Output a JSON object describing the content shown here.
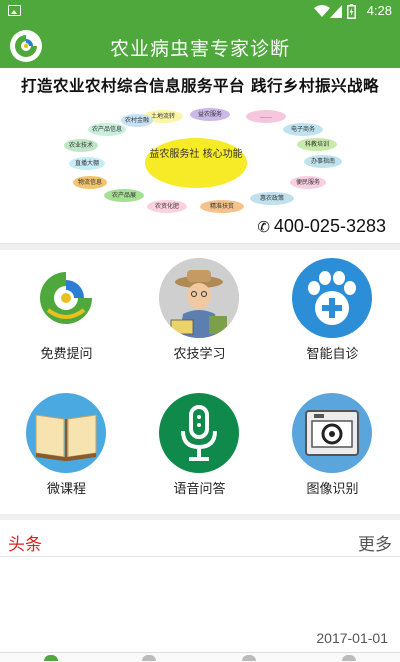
{
  "status_bar": {
    "time": "4:28"
  },
  "app_bar": {
    "title": "农业病虫害专家诊断"
  },
  "banner": {
    "slogan": "打造农业农村综合信息服务平台 践行乡村振兴战略",
    "core_label": "益农服务社 核心功能",
    "hotline": "400-025-3283",
    "services": [
      {
        "label": "土地流转",
        "color": "#fbf5a7"
      },
      {
        "label": "益农服务",
        "color": "#c9b8e8"
      },
      {
        "label": "……",
        "color": "#f5c6dc"
      },
      {
        "label": "电子商务",
        "color": "#bfe4f0"
      },
      {
        "label": "科教培训",
        "color": "#c7eaa9"
      },
      {
        "label": "办事指南",
        "color": "#bfe3ea"
      },
      {
        "label": "便民服务",
        "color": "#f7cfe1"
      },
      {
        "label": "惠农政策",
        "color": "#bfe0ec"
      },
      {
        "label": "精准扶贫",
        "color": "#f5c28c"
      },
      {
        "label": "农资化肥",
        "color": "#fbd1e0"
      },
      {
        "label": "农产品展",
        "color": "#a5df94"
      },
      {
        "label": "物流信息",
        "color": "#f3c46f"
      },
      {
        "label": "直播大棚",
        "color": "#c6ecf7"
      },
      {
        "label": "农业技术",
        "color": "#bfe6c7"
      },
      {
        "label": "农产品信息",
        "color": "#c8eedd"
      },
      {
        "label": "农村金融",
        "color": "#c6e2f4"
      }
    ]
  },
  "features": [
    {
      "label": "免费提问",
      "icon": "app-logo-icon"
    },
    {
      "label": "农技学习",
      "icon": "farmer-illustration-icon"
    },
    {
      "label": "智能自诊",
      "icon": "paw-plus-icon"
    },
    {
      "label": "微课程",
      "icon": "open-book-icon"
    },
    {
      "label": "语音问答",
      "icon": "microphone-icon"
    },
    {
      "label": "图像识别",
      "icon": "camera-icon"
    }
  ],
  "news": {
    "title": "头条",
    "more": "更多",
    "date": "2017-01-01"
  },
  "colors": {
    "primary": "#4fa83b",
    "headline": "#e02020"
  }
}
